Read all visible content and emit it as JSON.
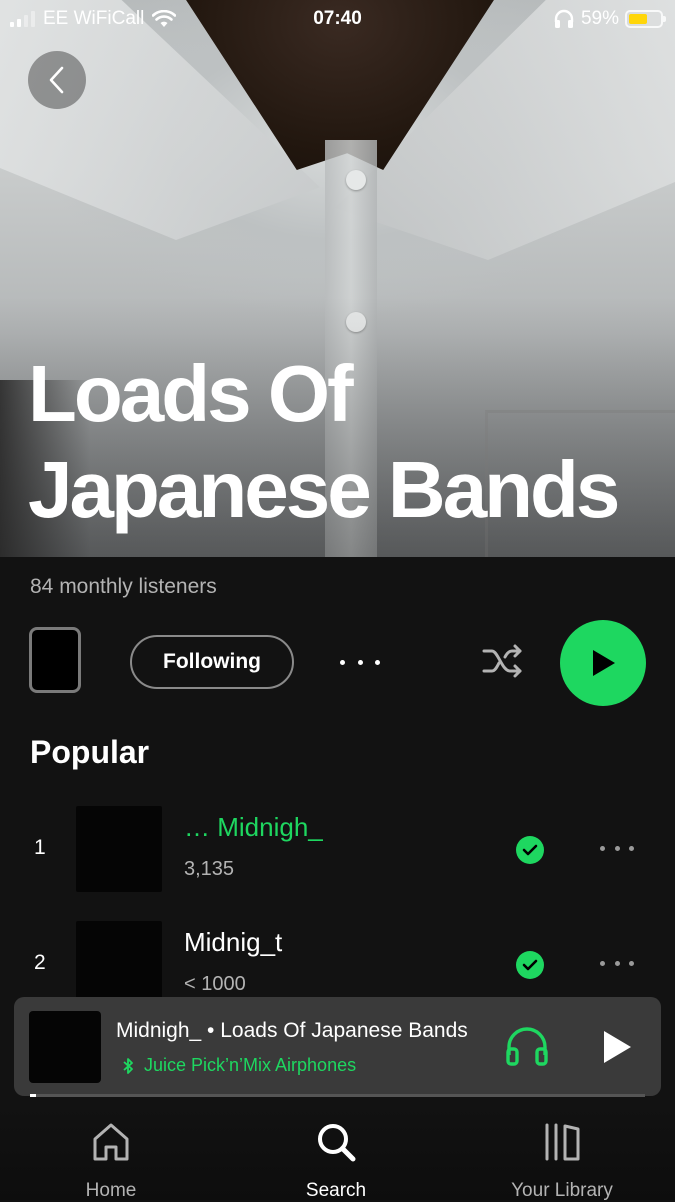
{
  "status_bar": {
    "carrier": "EE WiFiCall",
    "time": "07:40",
    "battery": "59%",
    "battery_level": 0.59
  },
  "artist": {
    "name": "Loads Of Japanese Bands",
    "monthly_listeners": "84 monthly listeners"
  },
  "actions": {
    "follow_label": "Following"
  },
  "popular": {
    "title": "Popular",
    "tracks": [
      {
        "rank": "1",
        "title": "… Midnigh_",
        "plays": "3,135",
        "playing": true,
        "saved": true
      },
      {
        "rank": "2",
        "title": "Midnig_t",
        "plays": "< 1000",
        "playing": false,
        "saved": true
      }
    ]
  },
  "now_playing": {
    "line": "Midnigh_ • Loads Of Japanese Bands",
    "device": "Juice Pick’n’Mix Airphones",
    "progress": 0.01
  },
  "tabs": [
    {
      "label": "Home",
      "icon": "home-icon",
      "active": false
    },
    {
      "label": "Search",
      "icon": "search-icon",
      "active": true
    },
    {
      "label": "Your Library",
      "icon": "library-icon",
      "active": false
    }
  ],
  "colors": {
    "accent": "#1ed760",
    "background": "#121212",
    "mini_player_bg": "#3a3a3a",
    "battery_fill": "#ffd60a"
  }
}
